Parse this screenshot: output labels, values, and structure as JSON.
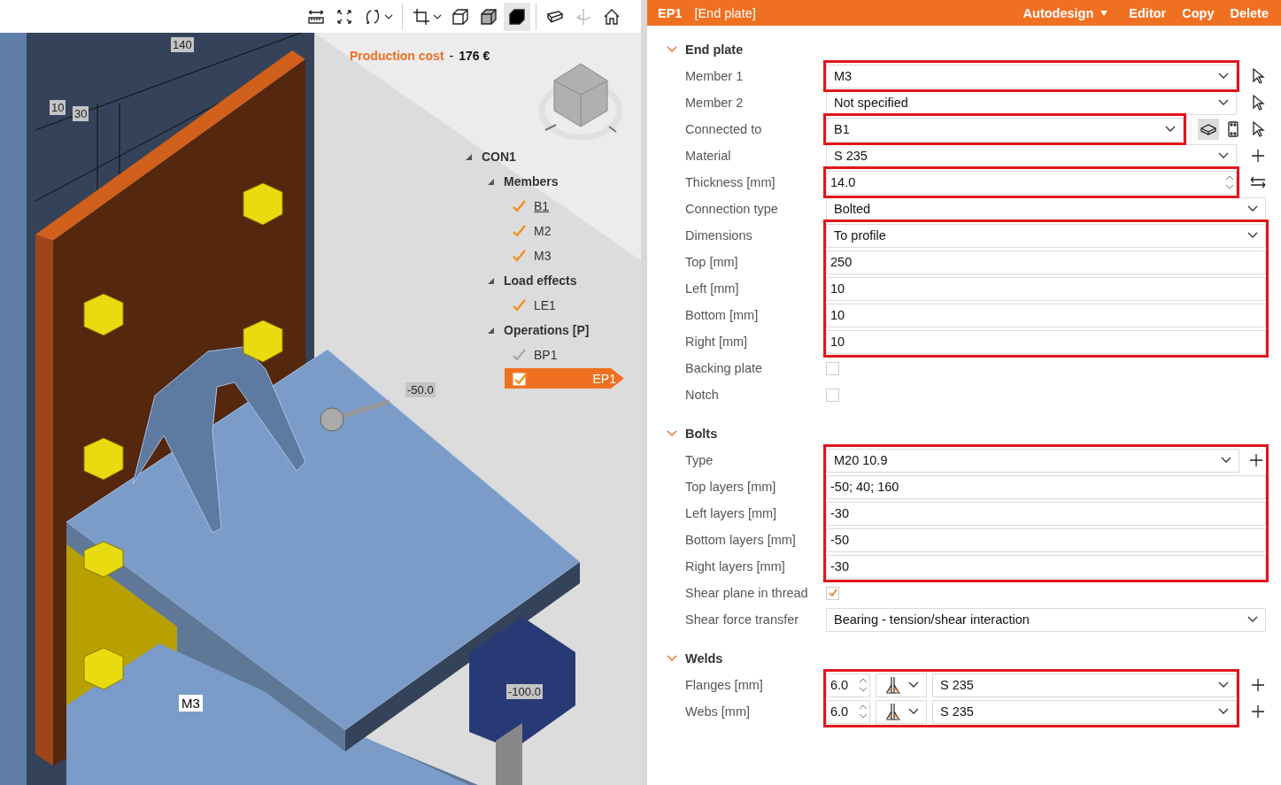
{
  "toolbar": [
    [
      {
        "kind": "measure",
        "selected": false,
        "disabled": false,
        "dropdown": false
      },
      {
        "kind": "fit",
        "selected": false,
        "disabled": false,
        "dropdown": false
      },
      {
        "kind": "rotate",
        "selected": false,
        "disabled": false,
        "dropdown": true
      }
    ],
    [
      {
        "kind": "crop",
        "selected": false,
        "disabled": false,
        "dropdown": true
      },
      {
        "kind": "wireframe",
        "selected": false,
        "disabled": false,
        "dropdown": false
      },
      {
        "kind": "transparent",
        "selected": false,
        "disabled": false,
        "dropdown": false
      },
      {
        "kind": "solid",
        "selected": true,
        "disabled": false,
        "dropdown": false
      }
    ],
    [
      {
        "kind": "section",
        "selected": false,
        "disabled": false,
        "dropdown": false
      },
      {
        "kind": "mirror",
        "selected": false,
        "disabled": true,
        "dropdown": false
      },
      {
        "kind": "home",
        "selected": false,
        "disabled": false,
        "dropdown": false
      }
    ]
  ],
  "viewport": {
    "cost": {
      "label": "Production cost",
      "separator": "-",
      "value": "176 €"
    },
    "dimension_labels": [
      "140",
      "10",
      "30",
      "-50.0",
      "-100.0"
    ],
    "member_label": "M3"
  },
  "tree": {
    "label": "CON1",
    "expanded": true,
    "children": [
      {
        "label": "Members",
        "expanded": true,
        "children": [
          {
            "label": "B1",
            "checked": true,
            "enabled": true,
            "linked": true,
            "selected": false
          },
          {
            "label": "M2",
            "checked": true,
            "enabled": true,
            "linked": false,
            "selected": false
          },
          {
            "label": "M3",
            "checked": true,
            "enabled": true,
            "linked": false,
            "selected": false
          }
        ]
      },
      {
        "label": "Load effects",
        "expanded": true,
        "children": [
          {
            "label": "LE1",
            "checked": true,
            "enabled": true,
            "linked": false,
            "selected": false
          }
        ]
      },
      {
        "label": "Operations [P]",
        "expanded": true,
        "children": [
          {
            "label": "BP1",
            "checked": true,
            "enabled": false,
            "linked": false,
            "selected": false
          },
          {
            "label": "EP1",
            "checked": true,
            "enabled": true,
            "linked": false,
            "selected": true
          }
        ]
      }
    ]
  },
  "panel": {
    "name": "EP1",
    "type": "[End plate]",
    "actions": [
      {
        "label": "Autodesign",
        "kind": "dropdown"
      },
      {
        "label": "Editor",
        "kind": "plain"
      },
      {
        "label": "Copy",
        "kind": "plain"
      },
      {
        "label": "Delete",
        "kind": "plain"
      }
    ],
    "sections": [
      {
        "title": "End plate",
        "expanded": true,
        "blocks": [
          {
            "highlighted": true,
            "rows": [
              {
                "label": "Member 1",
                "kind": "select",
                "value": "M3",
                "tools": [
                  {
                    "kind": "pointer",
                    "selected": false
                  }
                ]
              }
            ]
          },
          {
            "highlighted": false,
            "rows": [
              {
                "label": "Member 2",
                "kind": "select",
                "value": "Not specified",
                "tools": [
                  {
                    "kind": "pointer",
                    "selected": false
                  }
                ]
              }
            ]
          },
          {
            "highlighted": true,
            "rows": [
              {
                "label": "Connected to",
                "kind": "select",
                "value": "B1",
                "tools": [
                  {
                    "kind": "beam",
                    "selected": true
                  },
                  {
                    "kind": "plate",
                    "selected": false
                  },
                  {
                    "kind": "pointer",
                    "selected": false
                  }
                ]
              }
            ]
          },
          {
            "highlighted": false,
            "rows": [
              {
                "label": "Material",
                "kind": "select",
                "value": "S 235",
                "tools": [
                  {
                    "kind": "plus",
                    "selected": false
                  }
                ]
              }
            ]
          },
          {
            "highlighted": true,
            "rows": [
              {
                "label": "Thickness [mm]",
                "kind": "number",
                "value": "14.0",
                "tools": [
                  {
                    "kind": "swap",
                    "selected": false
                  }
                ]
              }
            ]
          },
          {
            "highlighted": false,
            "rows": [
              {
                "label": "Connection type",
                "kind": "select",
                "value": "Bolted",
                "tools": []
              }
            ]
          },
          {
            "highlighted": true,
            "rows": [
              {
                "label": "Dimensions",
                "kind": "select",
                "value": "To profile",
                "tools": []
              },
              {
                "label": "Top [mm]",
                "kind": "text",
                "value": "250",
                "tools": []
              },
              {
                "label": "Left [mm]",
                "kind": "text",
                "value": "10",
                "tools": []
              },
              {
                "label": "Bottom [mm]",
                "kind": "text",
                "value": "10",
                "tools": []
              },
              {
                "label": "Right [mm]",
                "kind": "text",
                "value": "10",
                "tools": []
              }
            ]
          },
          {
            "highlighted": false,
            "rows": [
              {
                "label": "Backing plate",
                "kind": "checkbox",
                "checked": false,
                "tools": []
              },
              {
                "label": "Notch",
                "kind": "checkbox",
                "checked": false,
                "tools": []
              }
            ]
          }
        ]
      },
      {
        "title": "Bolts",
        "expanded": true,
        "blocks": [
          {
            "highlighted": true,
            "rows": [
              {
                "label": "Type",
                "kind": "select",
                "value": "M20 10.9",
                "tools": [
                  {
                    "kind": "plus",
                    "selected": false
                  }
                ]
              },
              {
                "label": "Top layers [mm]",
                "kind": "text",
                "value": "-50; 40; 160",
                "tools": []
              },
              {
                "label": "Left layers [mm]",
                "kind": "text",
                "value": "-30",
                "tools": []
              },
              {
                "label": "Bottom layers [mm]",
                "kind": "text",
                "value": "-50",
                "tools": []
              },
              {
                "label": "Right layers [mm]",
                "kind": "text",
                "value": "-30",
                "tools": []
              }
            ]
          },
          {
            "highlighted": false,
            "rows": [
              {
                "label": "Shear plane in thread",
                "kind": "checkbox",
                "checked": true,
                "tools": []
              },
              {
                "label": "Shear force transfer",
                "kind": "select",
                "value": "Bearing - tension/shear interaction",
                "tools": []
              }
            ]
          }
        ]
      },
      {
        "title": "Welds",
        "expanded": true,
        "blocks": [
          {
            "highlighted": true,
            "rows": [
              {
                "label": "Flanges [mm]",
                "kind": "weld",
                "value": "6.0",
                "material": "S 235",
                "tools": [
                  {
                    "kind": "plus",
                    "selected": false
                  }
                ]
              },
              {
                "label": "Webs [mm]",
                "kind": "weld",
                "value": "6.0",
                "material": "S 235",
                "tools": [
                  {
                    "kind": "plus",
                    "selected": false
                  }
                ]
              }
            ]
          }
        ]
      }
    ]
  }
}
